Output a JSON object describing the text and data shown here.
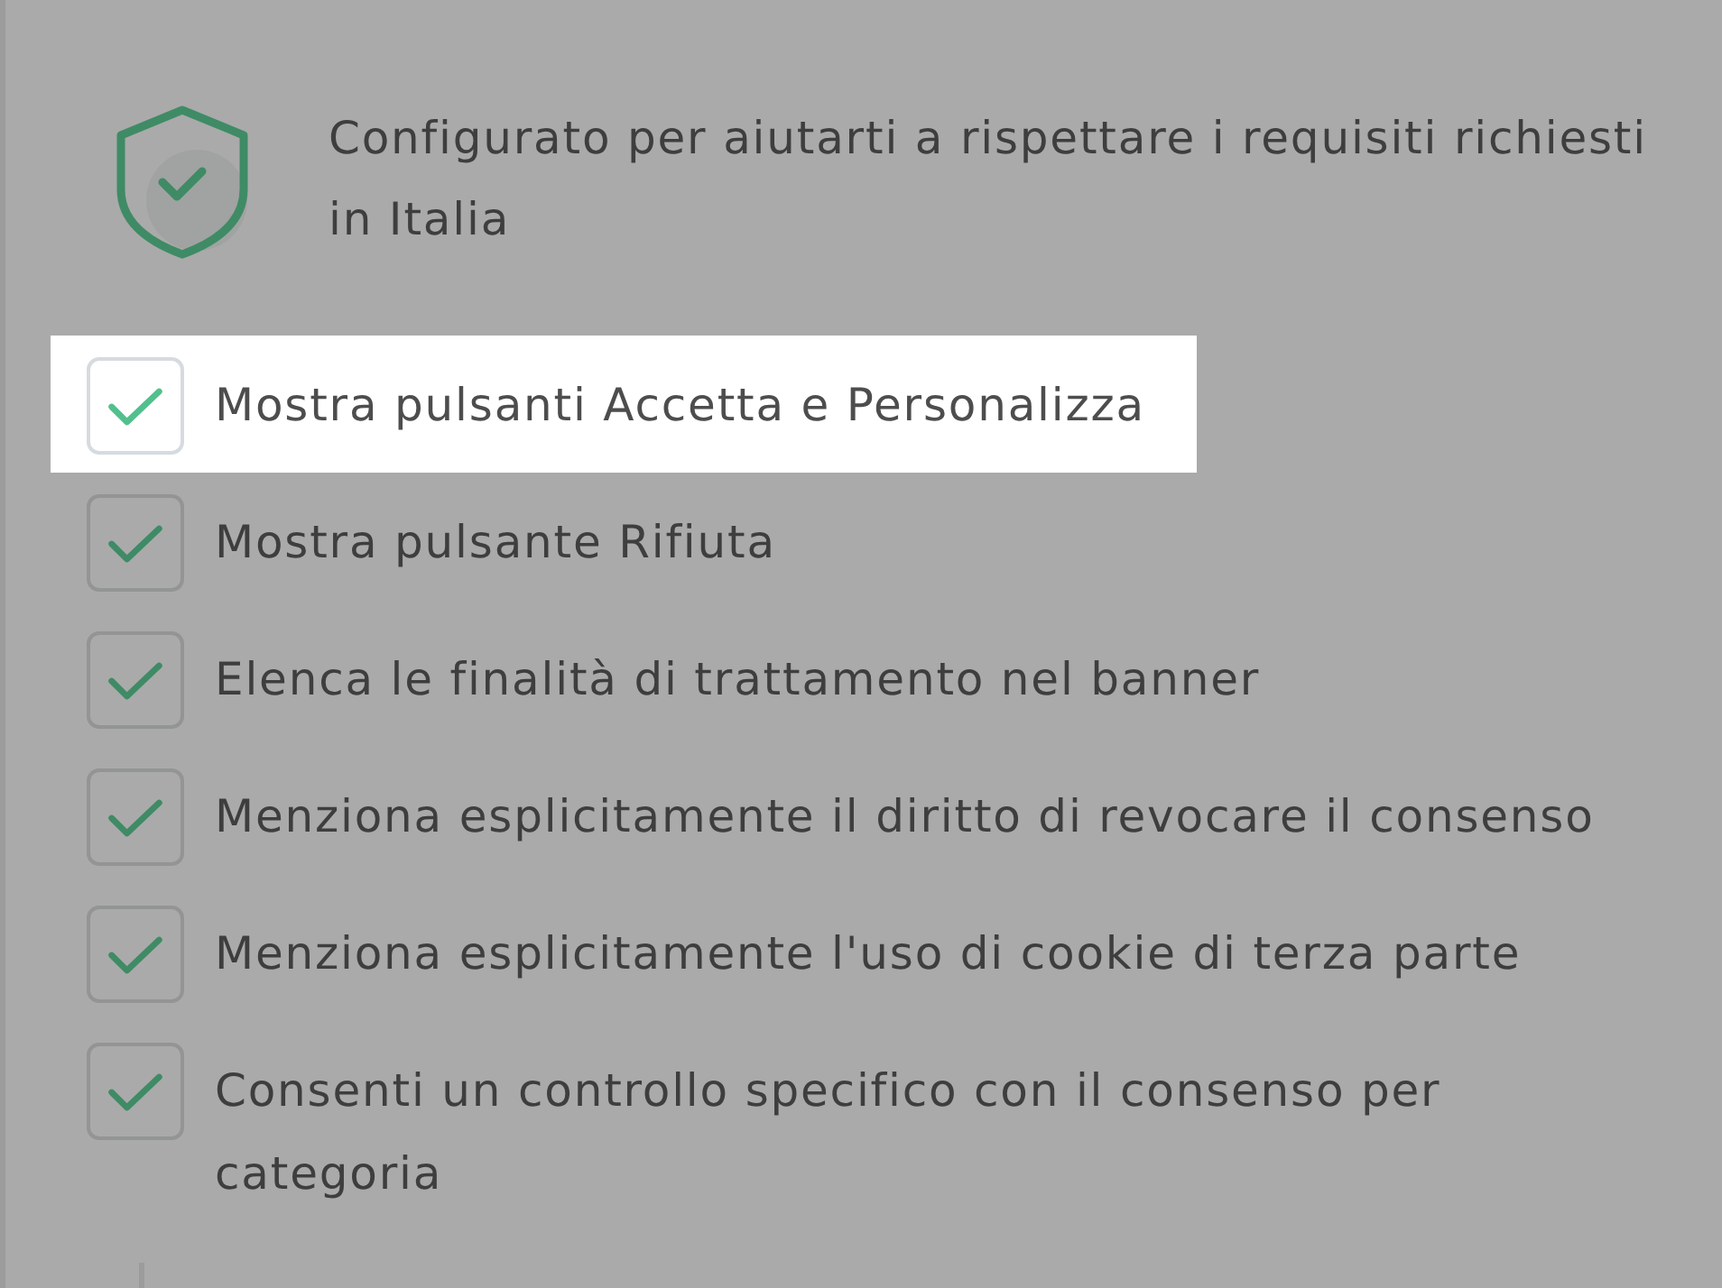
{
  "notice": {
    "text": "Configurato per aiutarti a rispettare i requisiti richiesti in Italia"
  },
  "options": [
    {
      "label": "Mostra pulsanti Accetta e Personalizza",
      "checked": true,
      "highlighted": true
    },
    {
      "label": "Mostra pulsante Rifiuta",
      "checked": true,
      "highlighted": false
    },
    {
      "label": "Elenca le finalità di trattamento nel banner",
      "checked": true,
      "highlighted": false
    },
    {
      "label": "Menziona esplicitamente il diritto di revocare il consenso",
      "checked": true,
      "highlighted": false
    },
    {
      "label": "Menziona esplicitamente l'uso di cookie di terza parte",
      "checked": true,
      "highlighted": false
    },
    {
      "label": "Consenti un controllo specifico con il consenso per categoria",
      "checked": true,
      "highlighted": false
    }
  ]
}
